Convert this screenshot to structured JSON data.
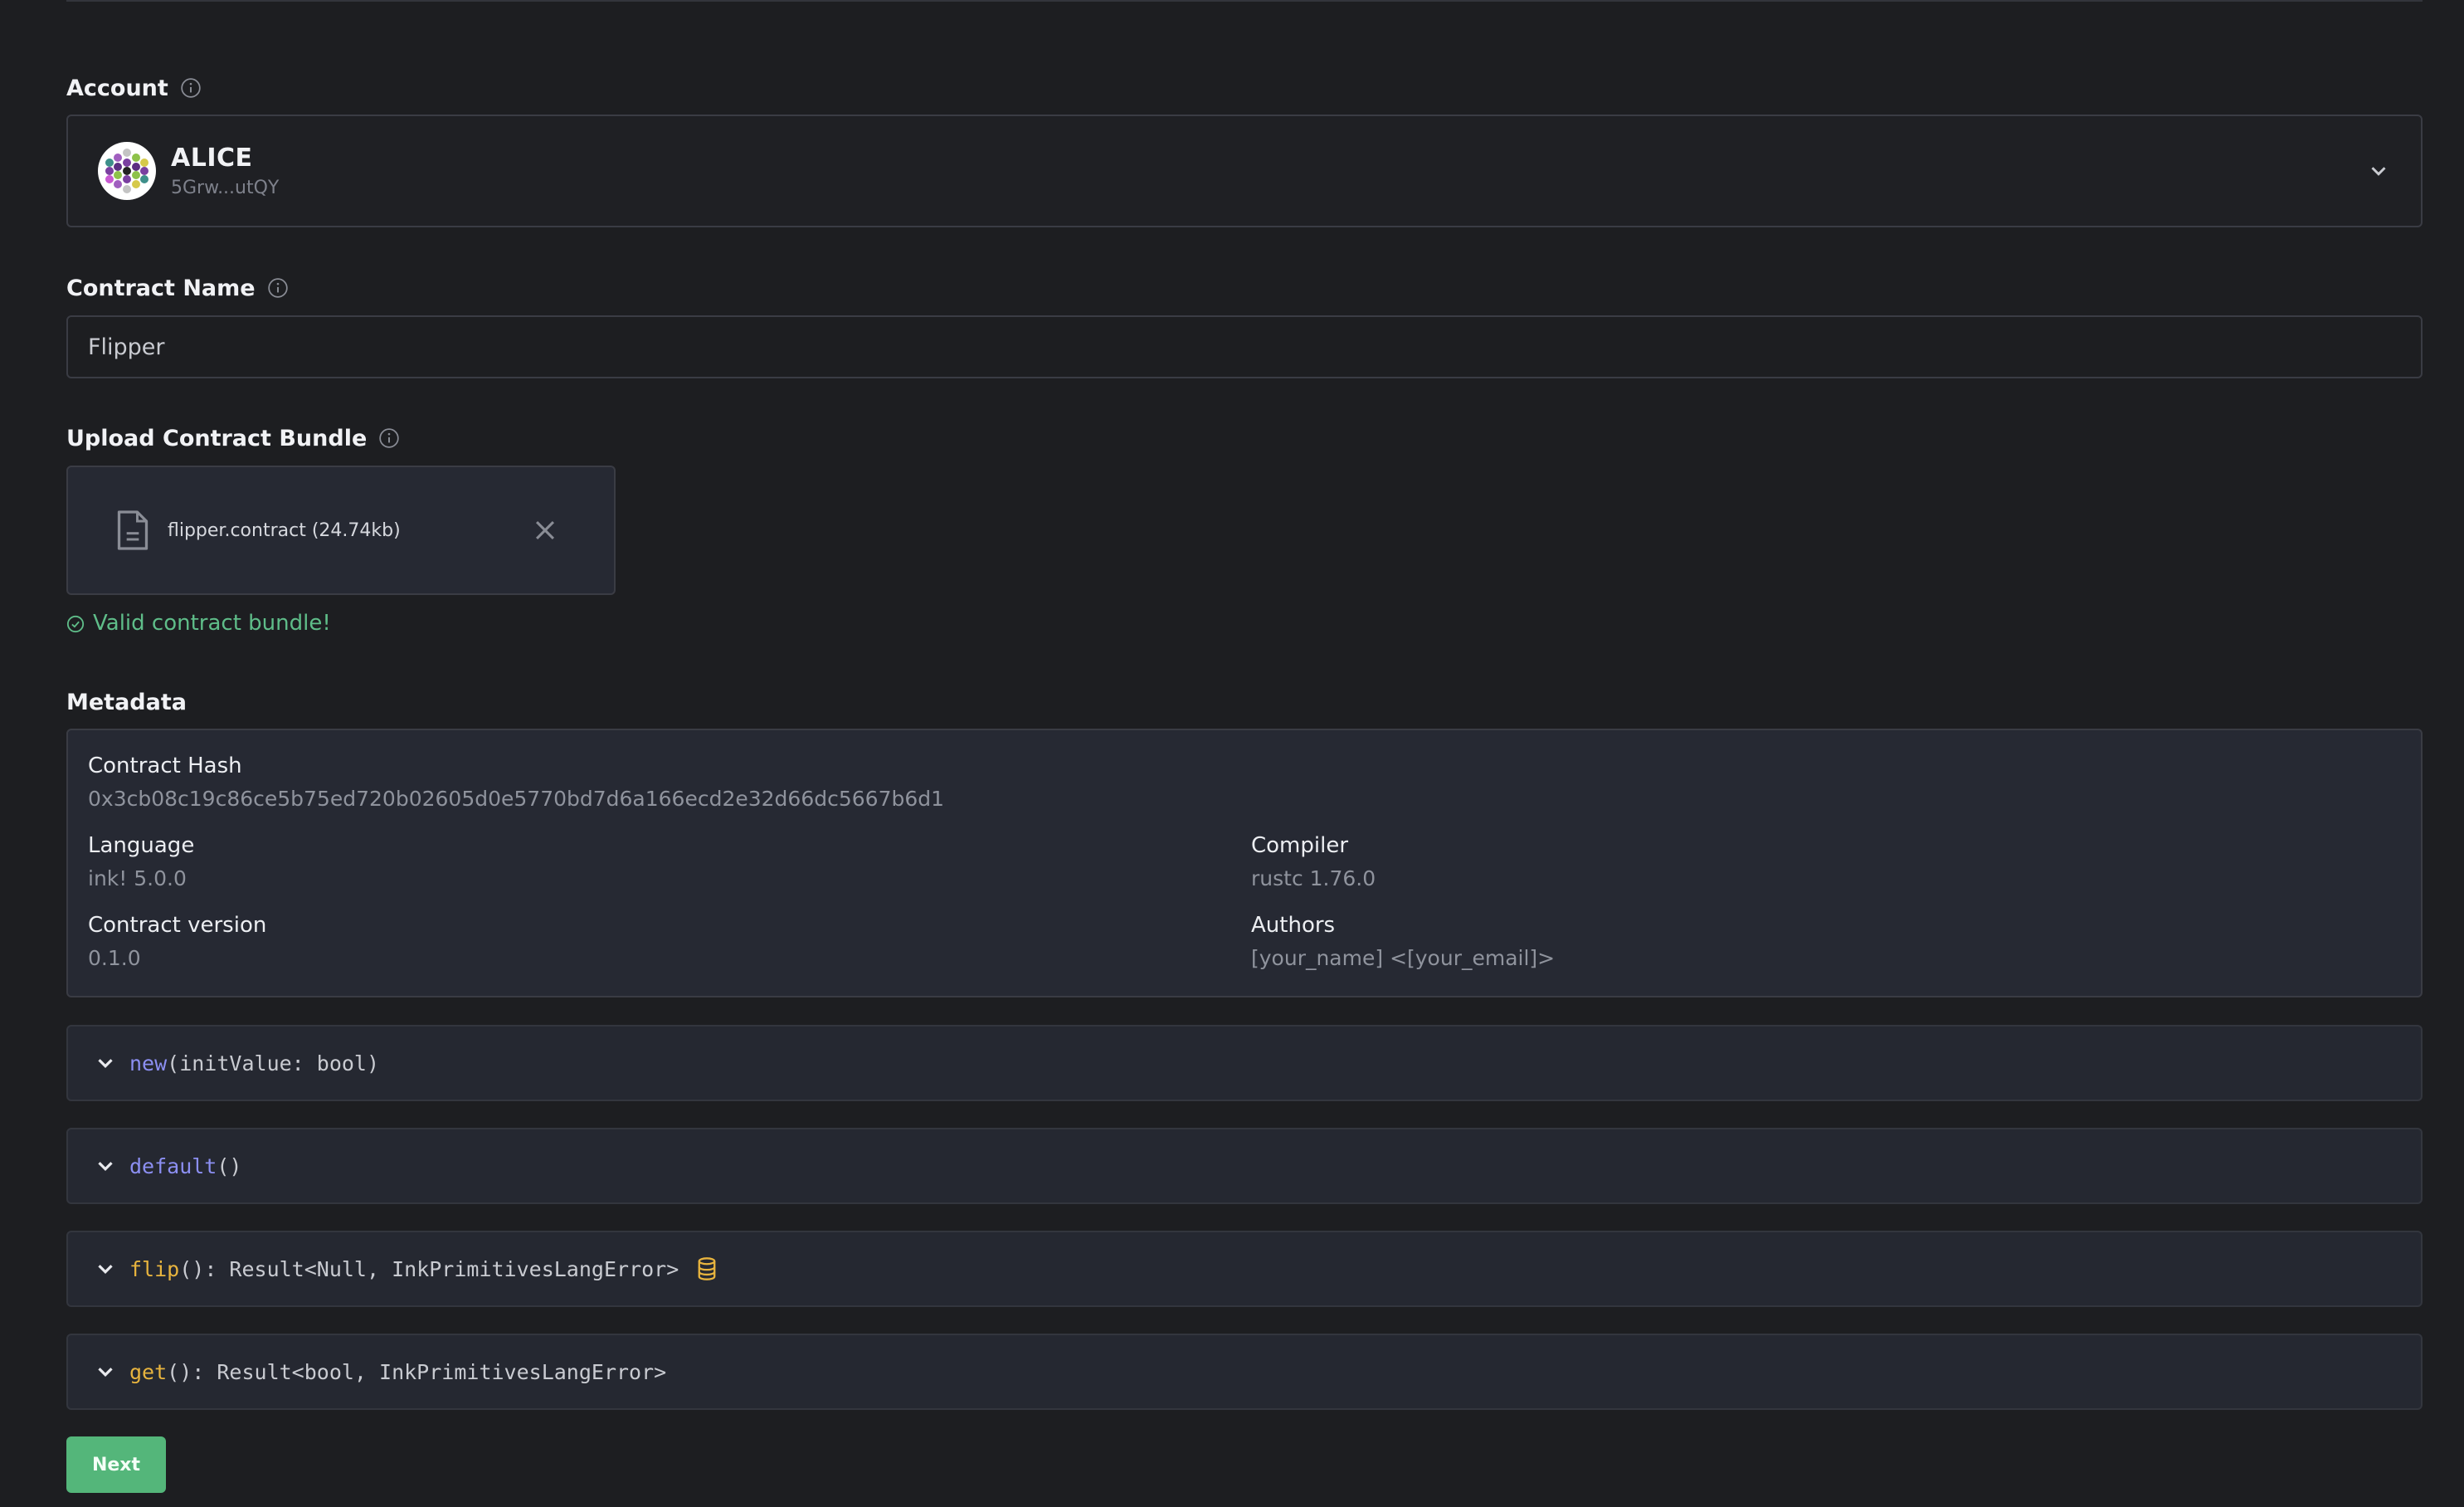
{
  "account": {
    "label": "Account",
    "name": "ALICE",
    "address": "5Grw...utQY"
  },
  "contract_name": {
    "label": "Contract Name",
    "value": "Flipper"
  },
  "upload": {
    "label": "Upload Contract Bundle",
    "file_name": "flipper.contract (24.74kb)",
    "status": "Valid contract bundle!"
  },
  "metadata": {
    "label": "Metadata",
    "hash_label": "Contract Hash",
    "hash_value": "0x3cb08c19c86ce5b75ed720b02605d0e5770bd7d6a166ecd2e32d66dc5667b6d1",
    "language_label": "Language",
    "language_value": "ink! 5.0.0",
    "compiler_label": "Compiler",
    "compiler_value": "rustc 1.76.0",
    "version_label": "Contract version",
    "version_value": "0.1.0",
    "authors_label": "Authors",
    "authors_value": "[your_name] <[your_email]>"
  },
  "messages": [
    {
      "name": "new",
      "signature": "(initValue: bool)",
      "color": "#8c8ff2",
      "icon": ""
    },
    {
      "name": "default",
      "signature": "()",
      "color": "#8c8ff2",
      "icon": ""
    },
    {
      "name": "flip",
      "signature": "(): Result<Null, InkPrimitivesLangError>",
      "color": "#e8b43e",
      "icon": "database-icon"
    },
    {
      "name": "get",
      "signature": "(): Result<bool, InkPrimitivesLangError>",
      "color": "#e8b43e",
      "icon": ""
    }
  ],
  "actions": {
    "next_label": "Next"
  },
  "colors": {
    "background": "#1d1e21",
    "panel": "#262933",
    "success": "#5fbd89",
    "button": "#54b67a"
  }
}
